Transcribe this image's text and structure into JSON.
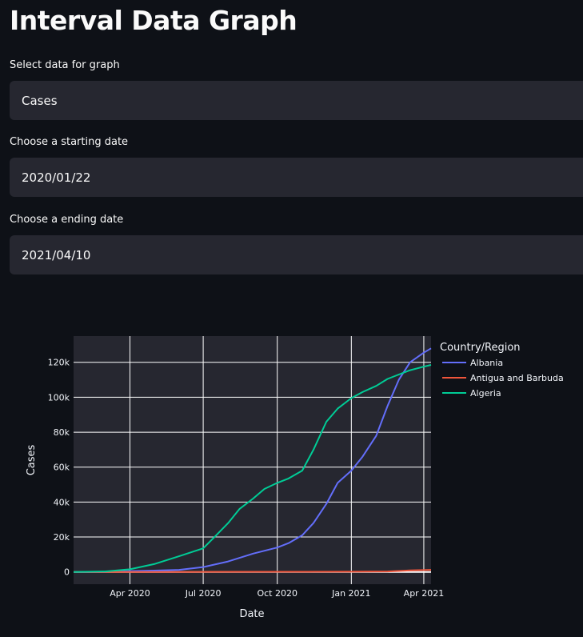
{
  "page": {
    "title": "Interval Data Graph"
  },
  "controls": {
    "data_select": {
      "label": "Select data for graph",
      "value": "Cases"
    },
    "start_date": {
      "label": "Choose a starting date",
      "value": "2020/01/22"
    },
    "end_date": {
      "label": "Choose a ending date",
      "value": "2021/04/10"
    }
  },
  "chart_data": {
    "type": "line",
    "xlabel": "Date",
    "ylabel": "Cases",
    "legend_title": "Country/Region",
    "legend_position": "right",
    "x_ticks": [
      "Apr 2020",
      "Jul 2020",
      "Oct 2020",
      "Jan 2021",
      "Apr 2021"
    ],
    "y_ticks": [
      "0",
      "20k",
      "40k",
      "60k",
      "80k",
      "100k",
      "120k"
    ],
    "xlim": [
      "2020-01-22",
      "2021-04-10"
    ],
    "ylim": [
      -7000,
      135000
    ],
    "series": [
      {
        "name": "Albania",
        "color": "#636efa",
        "x": [
          "2020-01-22",
          "2020-03-01",
          "2020-04-01",
          "2020-05-01",
          "2020-06-01",
          "2020-07-01",
          "2020-08-01",
          "2020-09-01",
          "2020-10-01",
          "2020-10-15",
          "2020-11-01",
          "2020-11-15",
          "2020-12-01",
          "2020-12-15",
          "2021-01-01",
          "2021-01-15",
          "2021-02-01",
          "2021-02-15",
          "2021-03-01",
          "2021-03-15",
          "2021-04-01",
          "2021-04-10"
        ],
        "y": [
          0,
          0,
          500,
          800,
          1200,
          2800,
          6000,
          10500,
          14000,
          16500,
          21000,
          28000,
          39000,
          51000,
          58000,
          66000,
          78000,
          95000,
          110000,
          120000,
          125500,
          128000
        ]
      },
      {
        "name": "Antigua and Barbuda",
        "color": "#ef553b",
        "x": [
          "2020-01-22",
          "2020-06-01",
          "2020-10-01",
          "2021-01-01",
          "2021-02-15",
          "2021-03-15",
          "2021-04-10"
        ],
        "y": [
          0,
          30,
          100,
          150,
          300,
          900,
          1200
        ]
      },
      {
        "name": "Algeria",
        "color": "#00cc96",
        "x": [
          "2020-01-22",
          "2020-03-01",
          "2020-04-01",
          "2020-05-01",
          "2020-06-01",
          "2020-07-01",
          "2020-07-15",
          "2020-08-01",
          "2020-08-15",
          "2020-09-01",
          "2020-09-15",
          "2020-10-01",
          "2020-10-15",
          "2020-11-01",
          "2020-11-15",
          "2020-12-01",
          "2020-12-15",
          "2021-01-01",
          "2021-01-15",
          "2021-02-01",
          "2021-02-15",
          "2021-03-01",
          "2021-03-15",
          "2021-04-01",
          "2021-04-10"
        ],
        "y": [
          0,
          300,
          1500,
          4500,
          9000,
          13500,
          20000,
          28000,
          36000,
          42000,
          47500,
          51000,
          53500,
          58000,
          70000,
          86000,
          93500,
          99500,
          103000,
          106500,
          110500,
          113000,
          115500,
          117500,
          118500
        ]
      }
    ]
  }
}
